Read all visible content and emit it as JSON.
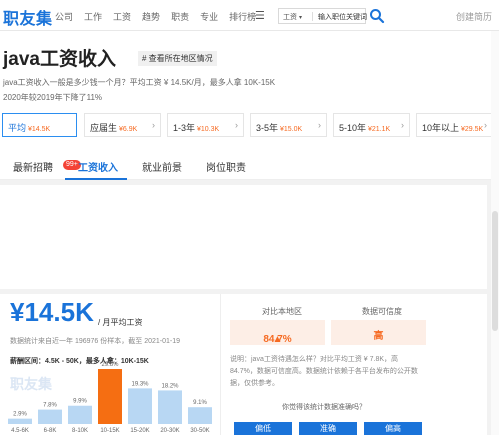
{
  "topbar": {
    "logo": "职友集",
    "nav": [
      "公司",
      "工作",
      "工资",
      "趋势",
      "职责",
      "专业",
      "排行榜"
    ],
    "search_type": "工资",
    "search_placeholder": "输入职位关键词",
    "create_resume": "创建简历"
  },
  "header": {
    "title": "java工资收入",
    "location_button": "# 查看所在地区情况",
    "description": "java工资收入一般是多少钱一个月？平均工资 ¥ 14.5K/月，最多人拿 10K-15K",
    "trend": "2020年较2019年下降了11%"
  },
  "experience": [
    {
      "label": "平均",
      "value": "¥14.5K"
    },
    {
      "label": "应届生",
      "value": "¥6.9K"
    },
    {
      "label": "1-3年",
      "value": "¥10.3K"
    },
    {
      "label": "3-5年",
      "value": "¥15.0K"
    },
    {
      "label": "5-10年",
      "value": "¥21.1K"
    },
    {
      "label": "10年以上",
      "value": "¥29.5K"
    }
  ],
  "tabs": [
    {
      "label": "最新招聘",
      "badge": "99+"
    },
    {
      "label": "工资收入"
    },
    {
      "label": "就业前景"
    },
    {
      "label": "岗位职责"
    }
  ],
  "salary": {
    "amount": "¥14.5K",
    "unit": "/ 月平均工资",
    "source": "数据统计来自近一年 196976 份样本，截至 2021-01-19",
    "range": "薪酬区间：4.5K - 50K，最多人拿：10K-15K",
    "watermark": "职友集"
  },
  "chart_data": {
    "type": "bar",
    "categories": [
      "4.5-6K",
      "6-8K",
      "8-10K",
      "10-15K",
      "15-20K",
      "20-30K",
      "30-50K"
    ],
    "values": [
      2.9,
      7.8,
      9.9,
      29.8,
      19.3,
      18.2,
      9.1
    ],
    "labels": [
      "2.9%",
      "7.8%",
      "9.9%",
      "29.8%",
      "19.3%",
      "18.2%",
      "9.1%"
    ],
    "highlight_index": 3,
    "colors": {
      "normal": "#b8d7f3",
      "highlight": "#f56e12"
    }
  },
  "compare": {
    "region_label": "对比本地区",
    "region_value": "84.7%",
    "trust_label": "数据可信度",
    "trust_value": "高",
    "note": "说明：java工资待遇怎么样？对比平均工资 ¥ 7.8K，高 84.7%，数据可信度高。数据统计依赖于各平台发布的公开数据，仅供参考。",
    "question": "你觉得该统计数据准确吗？",
    "feedback": [
      "偏低",
      "准确",
      "偏高"
    ]
  },
  "colors": {
    "brand": "#1a73d9",
    "accent": "#f66a22"
  }
}
